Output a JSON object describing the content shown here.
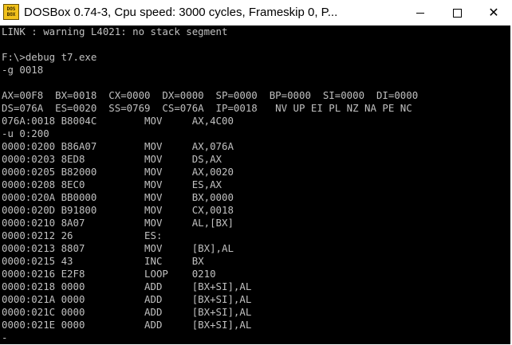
{
  "window": {
    "title": "DOSBox 0.74-3, Cpu speed:     3000 cycles, Frameskip  0, P...",
    "icon_text_top": "DOS",
    "icon_text_bottom": "BOX",
    "icons": {
      "app": "dosbox-icon",
      "minimize": "minimize-icon",
      "maximize": "maximize-icon",
      "close": "close-icon"
    },
    "close_glyph": "✕"
  },
  "colors": {
    "console_bg": "#000000",
    "console_text": "#c0c0c0",
    "icon_yellow": "#f2c21b"
  },
  "console": {
    "lines": [
      "LINK : warning L4021: no stack segment",
      "",
      "F:\\>debug t7.exe",
      "-g 0018",
      "",
      "AX=00F8  BX=0018  CX=0000  DX=0000  SP=0000  BP=0000  SI=0000  DI=0000",
      "DS=076A  ES=0020  SS=0769  CS=076A  IP=0018   NV UP EI PL NZ NA PE NC",
      "076A:0018 B8004C        MOV     AX,4C00",
      "-u 0:200",
      "0000:0200 B86A07        MOV     AX,076A",
      "0000:0203 8ED8          MOV     DS,AX",
      "0000:0205 B82000        MOV     AX,0020",
      "0000:0208 8EC0          MOV     ES,AX",
      "0000:020A BB0000        MOV     BX,0000",
      "0000:020D B91800        MOV     CX,0018",
      "0000:0210 8A07          MOV     AL,[BX]",
      "0000:0212 26            ES:",
      "0000:0213 8807          MOV     [BX],AL",
      "0000:0215 43            INC     BX",
      "0000:0216 E2F8          LOOP    0210",
      "0000:0218 0000          ADD     [BX+SI],AL",
      "0000:021A 0000          ADD     [BX+SI],AL",
      "0000:021C 0000          ADD     [BX+SI],AL",
      "0000:021E 0000          ADD     [BX+SI],AL",
      "-"
    ]
  }
}
